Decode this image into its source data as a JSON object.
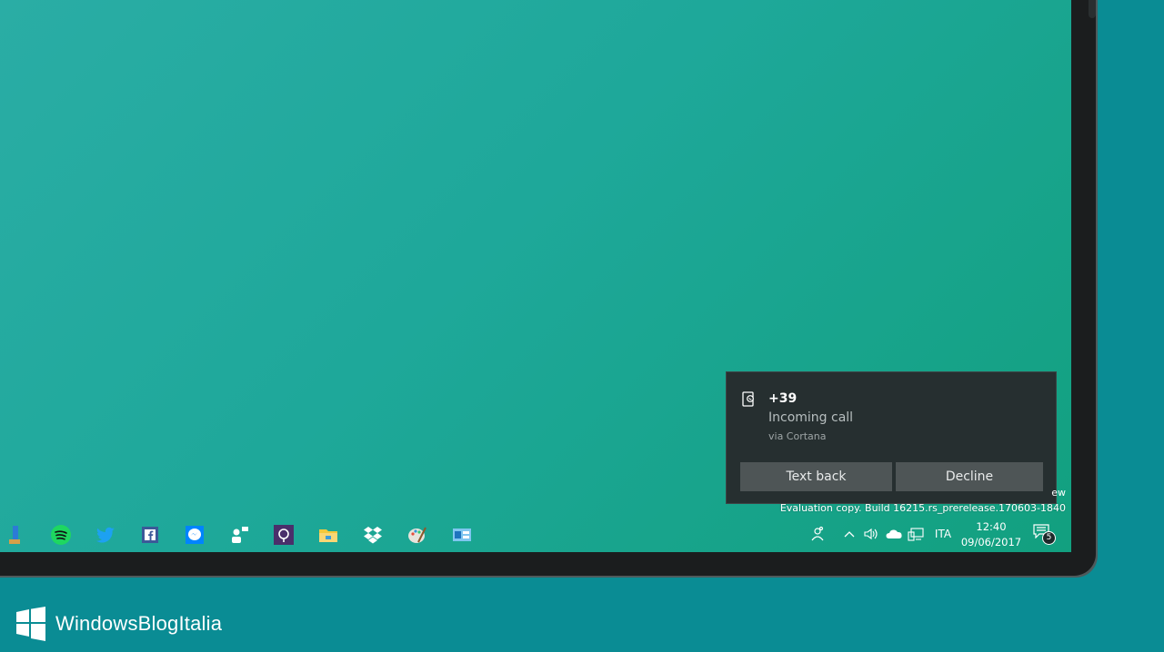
{
  "toast": {
    "title": "+39",
    "body": "Incoming call",
    "attribution": "via Cortana",
    "actions": {
      "text_back": "Text back",
      "decline": "Decline"
    },
    "icon": "phone-call-icon"
  },
  "watermark": {
    "line1_fragment": "ew",
    "line2": "Evaluation copy. Build 16215.rs_prerelease.170603-1840"
  },
  "taskbar": {
    "pinned_apps": [
      "app-icon",
      "spotify-icon",
      "twitter-icon",
      "facebook-icon",
      "messenger-icon",
      "people-icon",
      "onenote-icon",
      "file-explorer-icon",
      "dropbox-icon",
      "paint-icon",
      "control-panel-icon"
    ],
    "tray": {
      "icons": [
        "people-icon",
        "chevron-up-icon",
        "volume-icon",
        "onedrive-icon",
        "network-icon"
      ],
      "language": "ITA",
      "time": "12:40",
      "date": "09/06/2017",
      "notification_count": "5"
    }
  },
  "branding": {
    "name": "WindowsBlogItalia"
  },
  "colors": {
    "background": "#0a8c94",
    "toast_bg": "#262f30",
    "toast_button": "#4e5556",
    "spotify": "#1ed760",
    "twitter": "#1da1f2",
    "facebook": "#3b5998",
    "messenger": "#0084ff"
  }
}
